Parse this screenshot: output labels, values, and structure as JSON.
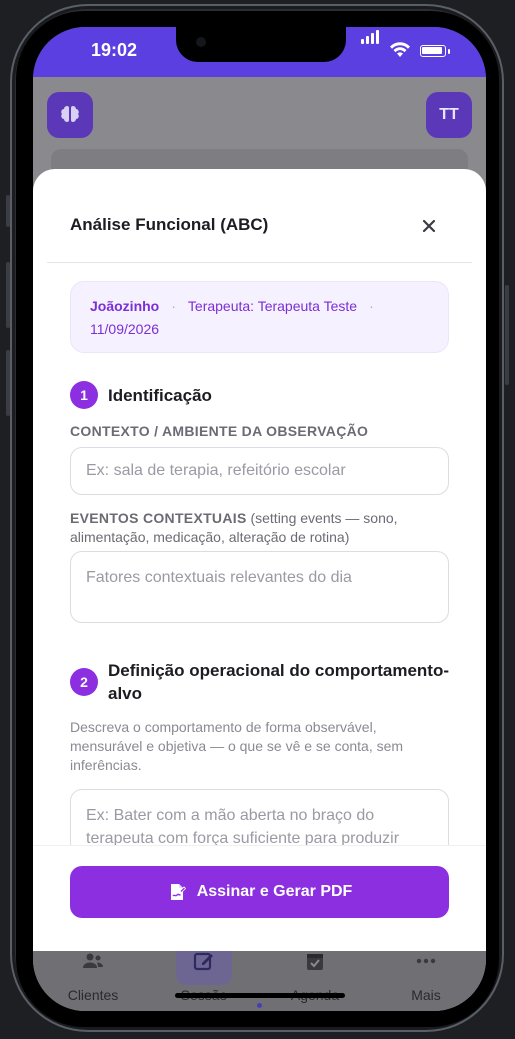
{
  "status_bar": {
    "time": "19:02"
  },
  "app": {
    "avatar_initials": "TT",
    "bottom_nav": [
      {
        "label": "Clientes",
        "icon": "people-icon"
      },
      {
        "label": "Sessão",
        "icon": "edit-icon",
        "active": true
      },
      {
        "label": "Agenda",
        "icon": "calendar-check-icon"
      },
      {
        "label": "Mais",
        "icon": "more-dots-icon"
      }
    ]
  },
  "modal": {
    "title": "Análise Funcional (ABC)",
    "info": {
      "patient": "Joãozinho",
      "therapist": "Terapeuta: Terapeuta Teste",
      "date": "11/09/2026"
    },
    "section1": {
      "number": "1",
      "title": "Identificação",
      "context_label": "CONTEXTO / AMBIENTE DA OBSERVAÇÃO",
      "context_placeholder": "Ex: sala de terapia, refeitório escolar",
      "events_label": "EVENTOS CONTEXTUAIS",
      "events_hint": " (setting events — sono, alimentação, medicação, alteração de rotina)",
      "events_placeholder": "Fatores contextuais relevantes do dia"
    },
    "section2": {
      "number": "2",
      "title": "Definição operacional do comportamento-alvo",
      "description": "Descreva o comportamento de forma observável, mensurável e objetiva — o que se vê e se conta, sem inferências.",
      "behavior_placeholder": "Ex: Bater com a mão aberta no braço do terapeuta com força suficiente para produzir"
    },
    "submit_label": "Assinar e Gerar PDF"
  },
  "colors": {
    "accent": "#8b2fe0",
    "status_bar": "#5b3fe0",
    "info_bg": "#f6f1ff"
  }
}
